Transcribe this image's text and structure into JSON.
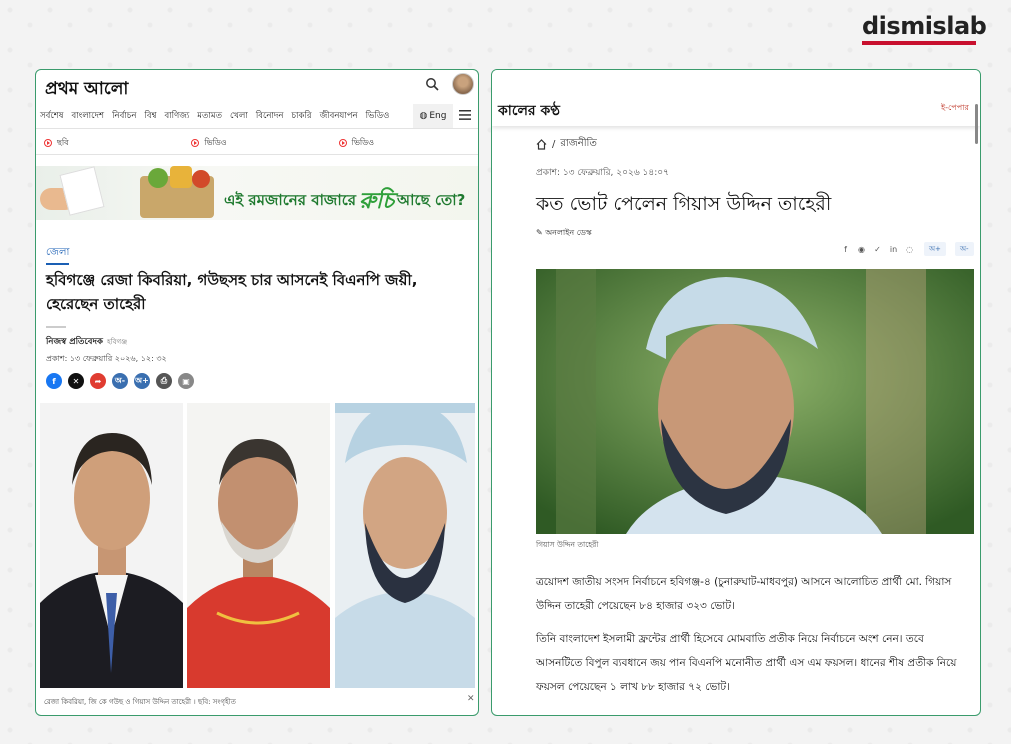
{
  "brand": {
    "name": "dismislab",
    "accent": "#c8102e"
  },
  "left": {
    "logo": "প্রথম আলো",
    "nav": [
      "সর্বশেষ",
      "বাংলাদেশ",
      "নির্বাচন",
      "বিশ্ব",
      "বাণিজ্য",
      "মতামত",
      "খেলা",
      "বিনোদন",
      "চাকরি",
      "জীবনযাপন",
      "ভিডিও"
    ],
    "lang_label": "Eng",
    "media": [
      "ছবি",
      "ভিডিও",
      "ভিডিও"
    ],
    "ad_text_1": "এই রমজানের বাজারে",
    "ad_brand": "রুচি",
    "ad_text_2": "আছে তো?",
    "category": "জেলা",
    "title": "হবিগঞ্জে রেজা কিবরিয়া, গউছসহ চার আসনেই বিএনপি জয়ী, হেরেছেন তাহেরী",
    "author": "নিজস্ব প্রতিবেদক",
    "author_location": "হবিগঞ্জ",
    "date": "প্রকাশ: ১৩ ফেব্রুয়ারি ২০২৬, ১২: ৩২",
    "share_icons": [
      {
        "name": "facebook-icon",
        "glyph": "f",
        "color": "#1877f2"
      },
      {
        "name": "x-icon",
        "glyph": "✕",
        "color": "#111"
      },
      {
        "name": "share-icon",
        "glyph": "➦",
        "color": "#e03c31"
      },
      {
        "name": "font-decrease-icon",
        "glyph": "অ-",
        "color": "#3a6fb0"
      },
      {
        "name": "font-increase-icon",
        "glyph": "অ+",
        "color": "#3a6fb0"
      },
      {
        "name": "print-icon",
        "glyph": "⎙",
        "color": "#555"
      },
      {
        "name": "bookmark-icon",
        "glyph": "▣",
        "color": "#888"
      }
    ],
    "caption": "রেজা কিবরিয়া, জি কে গউছ ও গিয়াস উদ্দিন তাহেরী । ছবি: সংগৃহীত",
    "close_glyph": "✕"
  },
  "right": {
    "logo": "কালের কণ্ঠ",
    "epaper": "ই-পেপার",
    "breadcrumb_sep": "/",
    "breadcrumb": "রাজনীতি",
    "date": "প্রকাশ: ১৩ ফেব্রুয়ারি, ২০২৬ ১৪:০৭",
    "title": "কত ভোট পেলেন গিয়াস উদ্দিন তাহেরী",
    "author": "অনলাইন ডেস্ক",
    "share_icons": [
      {
        "name": "facebook-icon",
        "glyph": "f"
      },
      {
        "name": "messenger-icon",
        "glyph": "◉"
      },
      {
        "name": "twitter-icon",
        "glyph": "✓"
      },
      {
        "name": "linkedin-icon",
        "glyph": "in"
      },
      {
        "name": "whatsapp-icon",
        "glyph": "◌"
      }
    ],
    "font_plus": "অ+",
    "font_minus": "অ-",
    "caption": "গিয়াস উদ্দিন তাহেরী",
    "para1": "ত্রয়োদশ জাতীয় সংসদ নির্বাচনে হবিগঞ্জ-৪ (চুনারুঘাট-মাধবপুর) আসনে আলোচিত প্রার্থী মো. গিয়াস উদ্দিন তাহেরী পেয়েছেন ৮৪ হাজার ৩২৩ ভোট।",
    "para2": "তিনি বাংলাদেশ ইসলামী ফ্রন্টের প্রার্থী হিসেবে মোমবাতি প্রতীক নিয়ে নির্বাচনে অংশ নেন। তবে আসনটিতে বিপুল ব্যবধানে জয় পান বিএনপি মনোনীত প্রার্থী এস এম ফয়সল। ধানের শীষ প্রতীক নিয়ে ফয়সল পেয়েছেন ১ লাখ ৮৮ হাজার ৭২ ভোট।"
  }
}
